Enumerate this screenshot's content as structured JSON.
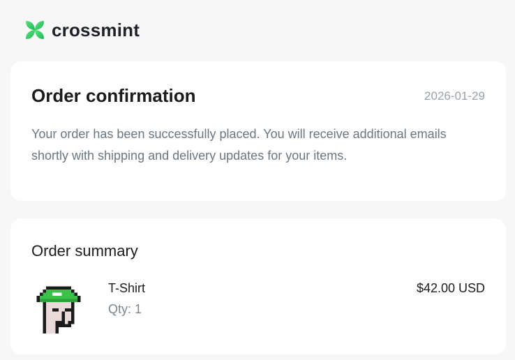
{
  "brand": {
    "name": "crossmint",
    "logo_icon": "crossmint-logo-icon",
    "accent_color": "#2cc55f"
  },
  "confirmation": {
    "title": "Order confirmation",
    "date": "2026-01-29",
    "message": "Your order has been successfully placed. You will receive additional emails shortly with shipping and delivery updates for your items."
  },
  "summary": {
    "title": "Order summary",
    "items": [
      {
        "name": "T-Shirt",
        "qty_label": "Qty:",
        "qty": "1",
        "price": "$42.00 USD",
        "image_icon": "pixel-avatar-image"
      }
    ]
  }
}
